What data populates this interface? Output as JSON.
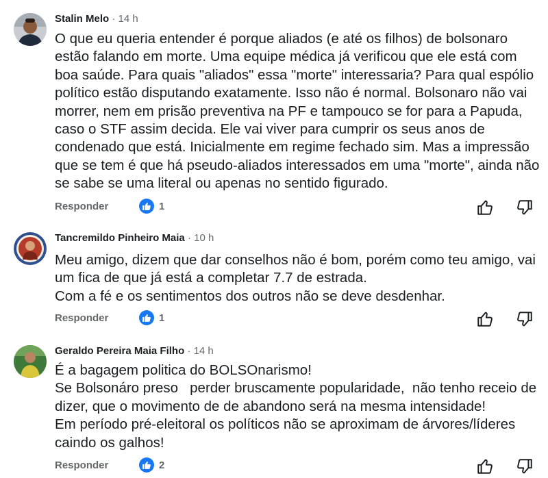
{
  "comments": [
    {
      "author": "Stalin Melo",
      "time": "14 h",
      "text": "O que eu queria entender é porque aliados (e até os filhos) de bolsonaro estão falando em morte. Uma equipe médica já verificou que ele está com boa saúde. Para quais \"aliados\" essa \"morte\" interessaria? Para qual espólio político estão disputando exatamente. Isso não é normal. Bolsonaro não vai morrer, nem em prisão preventiva na PF e tampouco se for para a Papuda, caso o STF assim decida. Ele vai viver para cumprir os seus anos de condenado que está. Inicialmente em regime fechado sim. Mas a impressão que se tem é que há pseudo-aliados interessados em uma \"morte\", ainda não se sabe se uma literal ou apenas no sentido figurado.",
      "reply_label": "Responder",
      "like_count": "1"
    },
    {
      "author": "Tancremildo Pinheiro Maia",
      "time": "10 h",
      "text": "Meu amigo, dizem que dar conselhos não é bom, porém como teu amigo, vai um fica de que já está a completar 7.7 de estrada.\nCom a fé e os sentimentos dos outros não se deve desdenhar.",
      "reply_label": "Responder",
      "like_count": "1"
    },
    {
      "author": "Geraldo Pereira Maia Filho",
      "time": "14 h",
      "text": "É a bagagem politica do BOLSOnarismo!\nSe Bolsonáro preso   perder bruscamente popularidade,  não tenho receio de dizer, que o movimento de de abandono será na mesma intensidade!\nEm período pré-eleitoral os políticos não se aproximam de árvores/líderes caindo os galhos!",
      "reply_label": "Responder",
      "like_count": "2"
    }
  ],
  "separator": "·",
  "colors": {
    "like_blue": "#1877f2",
    "meta_gray": "#65676b",
    "text": "#1c1e21"
  },
  "icons": {
    "like_badge": "thumbs-up-icon",
    "upvote": "thumbs-up-outline-icon",
    "downvote": "thumbs-down-outline-icon"
  }
}
